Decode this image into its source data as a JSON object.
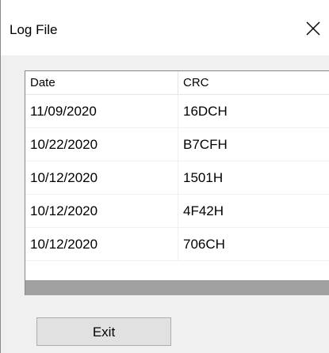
{
  "window": {
    "title": "Log File"
  },
  "listview": {
    "columns": [
      "Date",
      "CRC"
    ],
    "rows": [
      {
        "date": "11/09/2020",
        "crc": "16DCH"
      },
      {
        "date": "10/22/2020",
        "crc": "B7CFH"
      },
      {
        "date": "10/12/2020",
        "crc": "1501H"
      },
      {
        "date": "10/12/2020",
        "crc": "4F42H"
      },
      {
        "date": "10/12/2020",
        "crc": "706CH"
      }
    ]
  },
  "buttons": {
    "exit_label": "Exit"
  },
  "icons": {
    "close": "close-icon"
  },
  "colors": {
    "button_face": "#e1e1e1",
    "button_border": "#adadad",
    "scrollbar": "#a0a0a0",
    "dialog_background": "#f0f0f0"
  }
}
